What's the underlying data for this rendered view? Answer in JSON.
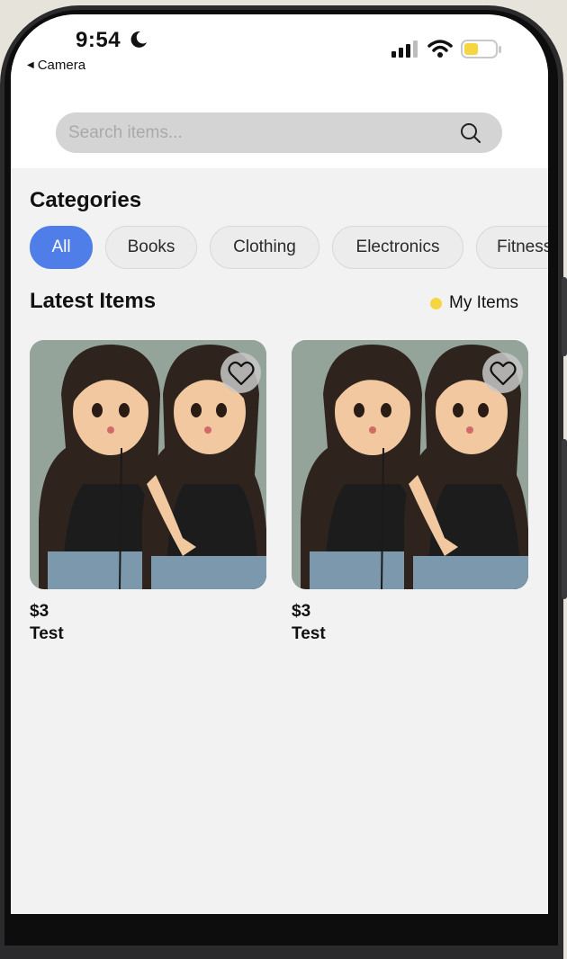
{
  "status_bar": {
    "time": "9:54",
    "back_app": "Camera"
  },
  "search": {
    "placeholder": "Search items..."
  },
  "categories": {
    "title": "Categories",
    "items": [
      "All",
      "Books",
      "Clothing",
      "Electronics",
      "Fitness"
    ],
    "selected": "All"
  },
  "latest": {
    "title": "Latest Items",
    "my_items_label": "My Items",
    "my_items_color": "#f6d640"
  },
  "items": [
    {
      "price": "$3",
      "title": "Test",
      "favorite_icon": "heart-outline-icon"
    },
    {
      "price": "$3",
      "title": "Test",
      "favorite_icon": "heart-outline-icon"
    }
  ],
  "colors": {
    "accent": "#4f7ee8",
    "battery": "#f6d640"
  }
}
